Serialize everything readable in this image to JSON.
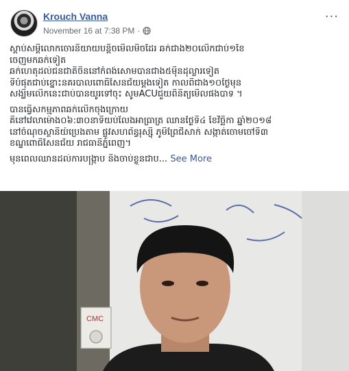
{
  "header": {
    "author": "Krouch Vanna",
    "timestamp": "November 16 at 7:38 PM",
    "separator": "·",
    "privacy_icon": "globe-icon",
    "more_icon": "more-options-icon",
    "more_glyph": "···"
  },
  "post": {
    "paragraphs": [
      {
        "lines": [
          "ស្តាប់សម្តីលោកចោរនិយាយបន្តិចមើលមិចដែរ ឆក់ជាង២០លើកជាប់១ខែ",
          "ចេញមកឆក់ទៀត",
          "ឆក់ហេតុដល់ជនជាតិចិននៅកំពង់សោមបានជាង៥ម៉ឺនដុល្លារទៀត",
          "ទីបំផុតជាប់ខ្នោះនគរបាលពោធិ៍សែនជ័យម្តងទៀត កាលពីជាង១០ថ្ងៃមុន",
          "សង្ឃឹមលើកនេះជាប់បានយូរទៅចុះ សូមACUជួយពិនិត្យមើលផងបាទ ។"
        ]
      },
      {
        "lines": [
          "បានធ្វើសកម្មភាពឆក់លើកចុងក្រោយ",
          "គឺនៅវេលាម៉ោង០៦:៣០នាទីយប់លែងអាធ្រាត្រ ឈានថ្ងៃទី៤ ខែវិច្ឆិកា ឆ្នាំ២០១៨",
          "នៅចំណុចស្ថានីយ៍ប្រេងតាម ផ្លូវសហព័ន្ធរុស្ស៊ី ភូមិព្រៃជីសាក់ សង្កាត់ចោមចៅទី៣",
          "ខណ្ឌពោធិ៍សែនជ័យ រាជធានីភ្នំពេញ។"
        ]
      },
      {
        "lines": [
          "មុនពេលឈានដល់ការបង្រ្កាប និងចាប់ខ្លួនជាប..."
        ],
        "see_more": "See More"
      }
    ]
  },
  "photo": {
    "badge_text": "CMC"
  }
}
